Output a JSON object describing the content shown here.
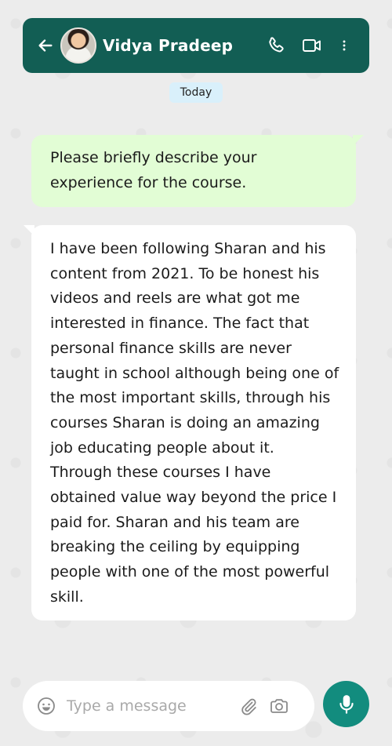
{
  "header": {
    "contact_name": "Vidya Pradeep",
    "icons": [
      "back-arrow-icon",
      "phone-icon",
      "video-icon",
      "more-options-icon"
    ],
    "color": "#125e54"
  },
  "date_chip": "Today",
  "messages": [
    {
      "direction": "outgoing",
      "text": "Please briefly describe your experience for the course.",
      "color": "#e2fdd5"
    },
    {
      "direction": "incoming",
      "text": "I have been following Sharan and his content from 2021. To be honest his videos and reels are what got me interested in finance. The fact that personal finance skills are never taught in school although being one of the most important skills, through his courses Sharan is doing an amazing job educating people about it. Through these courses I have obtained value way beyond the price I paid for. Sharan and his team are breaking the ceiling by equipping people with one of the most powerful skill.",
      "color": "#ffffff"
    }
  ],
  "composer": {
    "placeholder": "Type a message",
    "value": "",
    "icons": [
      "emoji-icon",
      "attach-icon",
      "camera-icon",
      "mic-icon"
    ],
    "mic_color": "#128c7e"
  }
}
